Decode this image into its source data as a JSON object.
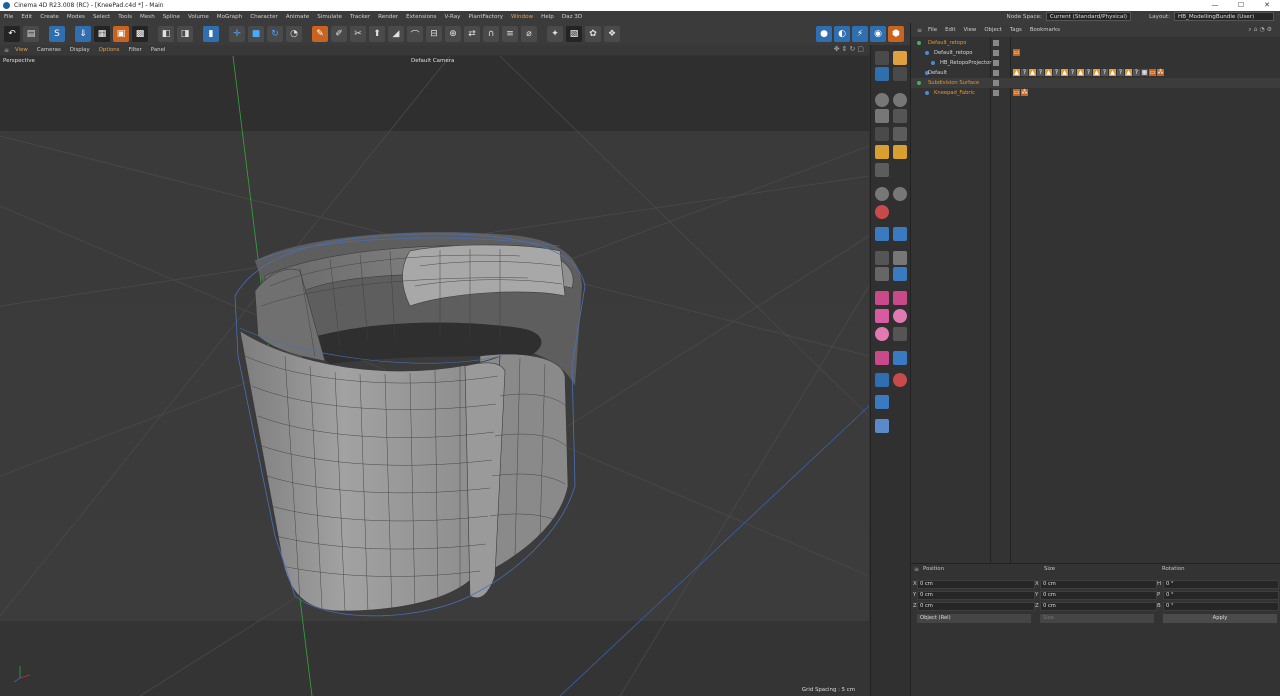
{
  "window": {
    "title": "Cinema 4D R23.008 (RC) - [KneePad.c4d *] - Main",
    "controls": [
      "—",
      "☐",
      "✕"
    ]
  },
  "menubar": {
    "items": [
      "File",
      "Edit",
      "Create",
      "Modes",
      "Select",
      "Tools",
      "Mesh",
      "Spline",
      "Volume",
      "MoGraph",
      "Character",
      "Animate",
      "Simulate",
      "Tracker",
      "Render",
      "Extensions",
      "V-Ray",
      "PlantFactory",
      "Window",
      "Help",
      "Daz 3D"
    ],
    "node_space_label": "Node Space:",
    "node_space_value": "Current (Standard/Physical)",
    "layout_label": "Layout:",
    "layout_value": "HB_ModellingBundle (User)"
  },
  "view_menu": {
    "items": [
      "View",
      "Cameras",
      "Display",
      "Options",
      "Filter",
      "Panel"
    ]
  },
  "viewport": {
    "projection": "Perspective",
    "camera": "Default Camera",
    "grid_spacing": "Grid Spacing : 5 cm"
  },
  "object_manager": {
    "menu": [
      "File",
      "Edit",
      "View",
      "Object",
      "Tags",
      "Bookmarks"
    ],
    "objects": [
      {
        "name": "Default_retopo",
        "color": "orange"
      },
      {
        "name": "Default_retopo",
        "color": "normal"
      },
      {
        "name": "HB_RetopoProjector",
        "color": "normal"
      },
      {
        "name": "Default",
        "color": "normal"
      },
      {
        "name": "Subdivision Surface",
        "color": "orange"
      },
      {
        "name": "Kneepad_Fabric",
        "color": "orange"
      }
    ]
  },
  "attributes": {
    "headers": {
      "position": "Position",
      "size": "Size",
      "rotation": "Rotation"
    },
    "rows": [
      {
        "axis": "X",
        "pos": "0 cm",
        "size_axis": "X",
        "size": "0 cm",
        "rot_axis": "H",
        "rot": "0 °"
      },
      {
        "axis": "Y",
        "pos": "0 cm",
        "size_axis": "Y",
        "size": "0 cm",
        "rot_axis": "P",
        "rot": "0 °"
      },
      {
        "axis": "Z",
        "pos": "0 cm",
        "size_axis": "Z",
        "size": "0 cm",
        "rot_axis": "B",
        "rot": "0 °"
      }
    ],
    "coord_mode": "Object (Rel)",
    "size_mode": "Size",
    "apply_label": "Apply"
  },
  "colors": {
    "accent_orange": "#e8962f",
    "accent_blue": "#2f6fb0",
    "mesh_wire": "#4a6fb8"
  }
}
